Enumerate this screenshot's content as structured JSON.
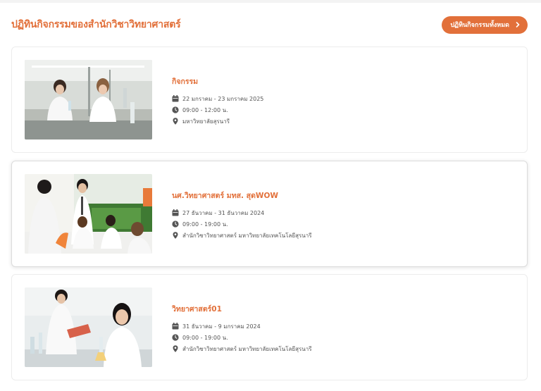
{
  "header": {
    "title": "ปฏิทินกิจกรรมของสำนักวิชาวิทยาศาสตร์",
    "all_button_label": "ปฏิทินกิจกรรมทั้งหมด"
  },
  "colors": {
    "accent": "#e2703a",
    "text_muted": "#555555",
    "icon": "#555555"
  },
  "icons": {
    "date": "calendar-icon",
    "time": "clock-icon",
    "location": "map-pin-icon",
    "button": "chevron-right-icon"
  },
  "events": [
    {
      "title": "กิจกรรม",
      "date": "22 มกราคม - 23 มกราคม 2025",
      "time": "09:00 - 12:00 น.",
      "location": "มหาวิทยาลัยสุรนารี"
    },
    {
      "title": "นศ.วิทยาศาสตร์ มทส. สุดWOW",
      "date": "27 ธันวาคม - 31 ธันวาคม 2024",
      "time": "09:00 - 19:00 น.",
      "location": "สำนักวิชาวิทยาศาสตร์ มหาวิทยาลัยเทคโนโลยีสุรนารี"
    },
    {
      "title": "วิทยาศาสตร์01",
      "date": "31 ธันวาคม - 9 มกราคม 2024",
      "time": "09:00 - 19:00 น.",
      "location": "สำนักวิชาวิทยาศาสตร์ มหาวิทยาลัยเทคโนโลยีสุรนารี"
    }
  ]
}
